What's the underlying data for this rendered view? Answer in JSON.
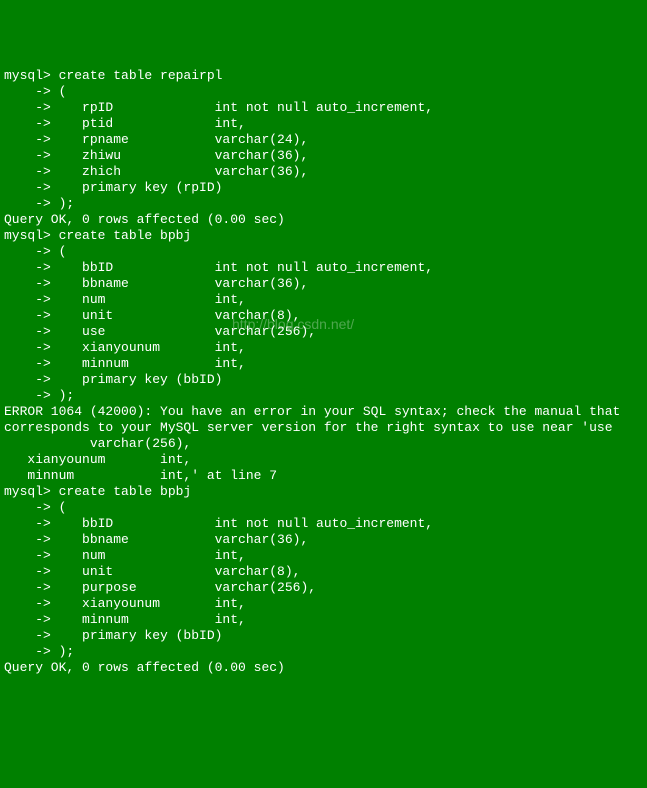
{
  "watermark": "http://blog.csdn.net/",
  "lines": [
    "mysql> create table repairpl",
    "    -> (",
    "    ->    rpID             int not null auto_increment,",
    "    ->    ptid             int,",
    "    ->    rpname           varchar(24),",
    "    ->    zhiwu            varchar(36),",
    "    ->    zhich            varchar(36),",
    "    ->    primary key (rpID)",
    "    -> );",
    "Query OK, 0 rows affected (0.00 sec)",
    "",
    "mysql> create table bpbj",
    "    -> (",
    "    ->    bbID             int not null auto_increment,",
    "    ->    bbname           varchar(36),",
    "    ->    num              int,",
    "    ->    unit             varchar(8),",
    "    ->    use              varchar(256),",
    "    ->    xianyounum       int,",
    "    ->    minnum           int,",
    "    ->    primary key (bbID)",
    "    -> );",
    "ERROR 1064 (42000): You have an error in your SQL syntax; check the manual that",
    "corresponds to your MySQL server version for the right syntax to use near 'use",
    "           varchar(256),",
    "   xianyounum       int,",
    "   minnum           int,' at line 7",
    "mysql> create table bpbj",
    "    -> (",
    "    ->    bbID             int not null auto_increment,",
    "    ->    bbname           varchar(36),",
    "    ->    num              int,",
    "    ->    unit             varchar(8),",
    "    ->    purpose          varchar(256),",
    "    ->    xianyounum       int,",
    "    ->    minnum           int,",
    "    ->    primary key (bbID)",
    "    -> );",
    "Query OK, 0 rows affected (0.00 sec)"
  ]
}
